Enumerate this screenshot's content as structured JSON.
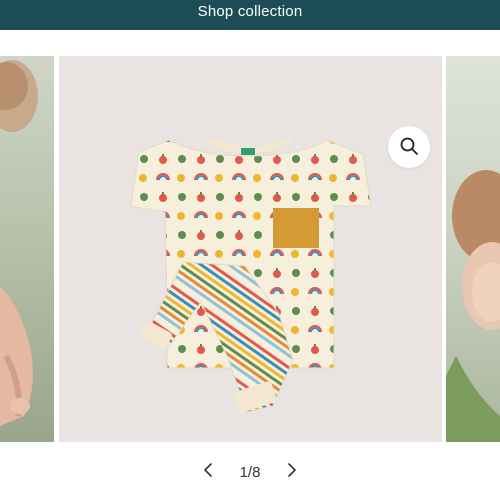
{
  "header": {
    "button_label": "Shop collection"
  },
  "gallery": {
    "counter": "1/8",
    "zoom_icon": "search-icon",
    "prev_icon": "chevron-left-icon",
    "next_icon": "chevron-right-icon"
  },
  "colors": {
    "banner": "#1d4e57",
    "slide_background": "#e9e3e1",
    "fabric": "#f6efdc",
    "pocket": "#d49a34"
  }
}
